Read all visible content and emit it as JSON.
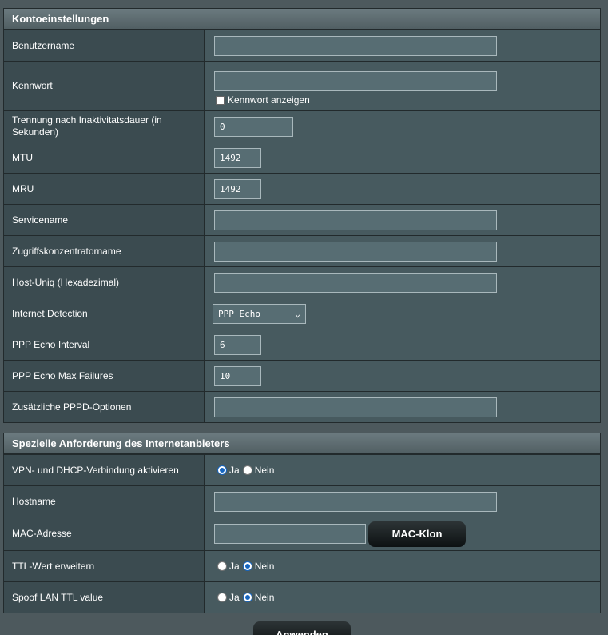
{
  "account": {
    "header": "Kontoeinstellungen",
    "username_label": "Benutzername",
    "username_value": "",
    "password_label": "Kennwort",
    "password_value": "",
    "show_password_label": "Kennwort anzeigen",
    "idle_label": "Trennung nach Inaktivitatsdauer (in Sekunden)",
    "idle_value": "0",
    "mtu_label": "MTU",
    "mtu_value": "1492",
    "mru_label": "MRU",
    "mru_value": "1492",
    "service_label": "Servicename",
    "service_value": "",
    "ac_label": "Zugriffskonzentratorname",
    "ac_value": "",
    "hostuniq_label": "Host-Uniq (Hexadezimal)",
    "hostuniq_value": "",
    "detection_label": "Internet Detection",
    "detection_selected": "PPP Echo",
    "echo_interval_label": "PPP Echo Interval",
    "echo_interval_value": "6",
    "echo_fail_label": "PPP Echo Max Failures",
    "echo_fail_value": "10",
    "pppd_label": "Zusätzliche PPPD-Optionen",
    "pppd_value": ""
  },
  "isp": {
    "header": "Spezielle Anforderung des Internetanbieters",
    "vpn_dhcp_label": "VPN- und DHCP-Verbindung aktivieren",
    "vpn_dhcp_selected": "Ja",
    "hostname_label": "Hostname",
    "hostname_value": "",
    "mac_label": "MAC-Adresse",
    "mac_value": "",
    "mac_clone_label": "MAC-Klon",
    "ttl_label": "TTL-Wert erweitern",
    "ttl_selected": "Nein",
    "spoof_label": "Spoof LAN TTL value",
    "spoof_selected": "Nein",
    "yes": "Ja",
    "no": "Nein"
  },
  "apply_label": "Anwenden",
  "colors": {
    "background": "#4d595d",
    "label_cell": "#3b4b50",
    "value_cell": "#475a5f",
    "radio_accent": "#1565c0"
  }
}
